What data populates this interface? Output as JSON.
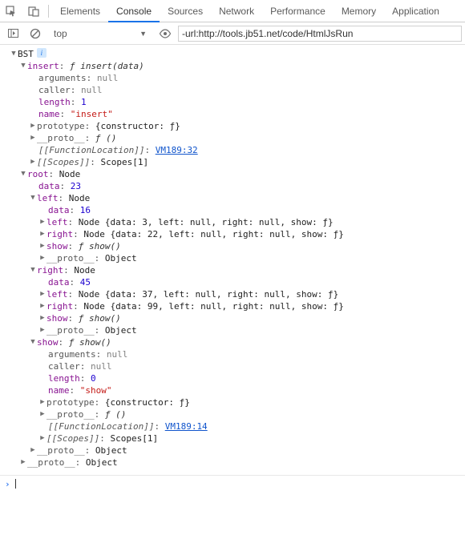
{
  "tabs": {
    "elements": "Elements",
    "console": "Console",
    "sources": "Sources",
    "network": "Network",
    "performance": "Performance",
    "memory": "Memory",
    "application": "Application"
  },
  "toolbar": {
    "context": "top",
    "filter_value": "-url:http://tools.jb51.net/code/HtmlJsRun"
  },
  "tree": {
    "root_label": "BST",
    "insert": {
      "key": "insert",
      "sig": "ƒ insert(data)",
      "arguments_key": "arguments",
      "arguments_val": "null",
      "caller_key": "caller",
      "caller_val": "null",
      "length_key": "length",
      "length_val": "1",
      "name_key": "name",
      "name_val": "\"insert\"",
      "prototype_key": "prototype",
      "prototype_val": "{constructor: ƒ}",
      "proto_key": "__proto__",
      "proto_val": "ƒ ()",
      "funcloc_key": "[[FunctionLocation]]",
      "funcloc_val": "VM189:32",
      "scopes_key": "[[Scopes]]",
      "scopes_val": "Scopes[1]"
    },
    "root": {
      "key": "root",
      "val": "Node",
      "data_key": "data",
      "data_val": "23",
      "left": {
        "key": "left",
        "val": "Node",
        "data_key": "data",
        "data_val": "16",
        "left_line": "Node {data: 3, left: null, right: null, show: ƒ}",
        "left_key": "left",
        "right_line": "Node {data: 22, left: null, right: null, show: ƒ}",
        "right_key": "right",
        "show_key": "show",
        "show_val": "ƒ show()",
        "proto_key": "__proto__",
        "proto_val": "Object"
      },
      "right": {
        "key": "right",
        "val": "Node",
        "data_key": "data",
        "data_val": "45",
        "left_line": "Node {data: 37, left: null, right: null, show: ƒ}",
        "left_key": "left",
        "right_line": "Node {data: 99, left: null, right: null, show: ƒ}",
        "right_key": "right",
        "show_key": "show",
        "show_val": "ƒ show()",
        "proto_key": "__proto__",
        "proto_val": "Object"
      },
      "show": {
        "key": "show",
        "sig": "ƒ show()",
        "arguments_key": "arguments",
        "arguments_val": "null",
        "caller_key": "caller",
        "caller_val": "null",
        "length_key": "length",
        "length_val": "0",
        "name_key": "name",
        "name_val": "\"show\"",
        "prototype_key": "prototype",
        "prototype_val": "{constructor: ƒ}",
        "proto_key": "__proto__",
        "proto_val": "ƒ ()",
        "funcloc_key": "[[FunctionLocation]]",
        "funcloc_val": "VM189:14",
        "scopes_key": "[[Scopes]]",
        "scopes_val": "Scopes[1]"
      },
      "proto_key": "__proto__",
      "proto_val": "Object"
    },
    "proto_key": "__proto__",
    "proto_val": "Object"
  }
}
